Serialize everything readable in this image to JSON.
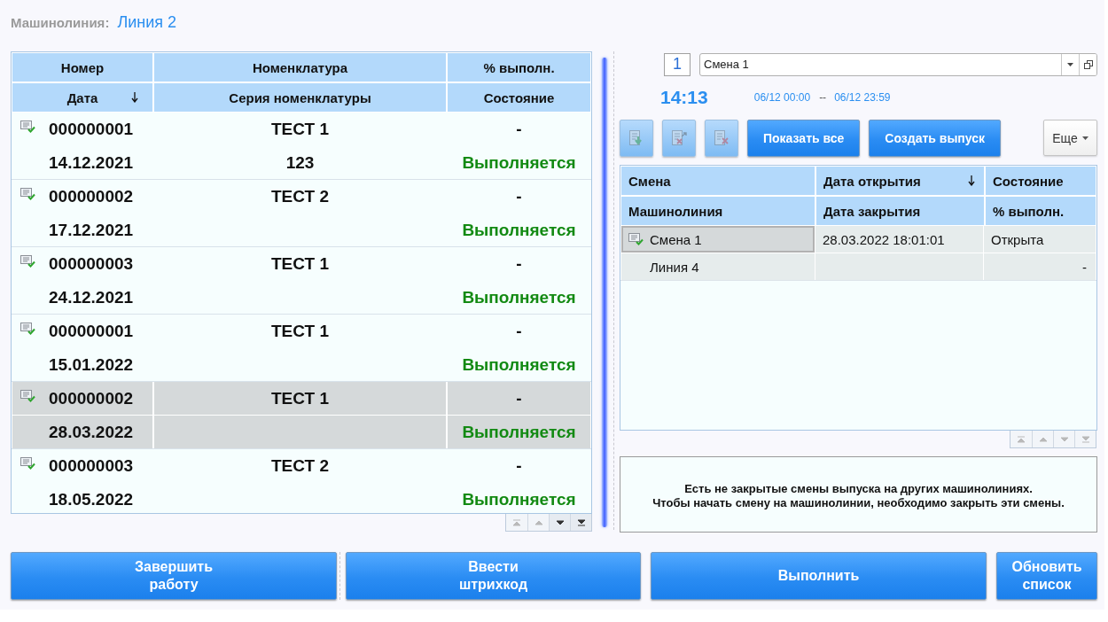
{
  "header": {
    "label": "Машинолиния:",
    "value": "Линия 2"
  },
  "orders_table": {
    "header_rows": [
      [
        {
          "label": "Номер",
          "sorted": false
        },
        {
          "label": "Номенклатура",
          "sorted": false
        },
        {
          "label": "% выполн.",
          "sorted": false
        }
      ],
      [
        {
          "label": "Дата",
          "sorted": true
        },
        {
          "label": "Серия номенклатуры",
          "sorted": false
        },
        {
          "label": "Состояние",
          "sorted": false
        }
      ]
    ],
    "rows": [
      {
        "number": "000000001",
        "date": "14.12.2021",
        "nomenclature": "ТЕСТ 1",
        "series": "123",
        "percent": "-",
        "status": "Выполняется",
        "selected": false
      },
      {
        "number": "000000002",
        "date": "17.12.2021",
        "nomenclature": "ТЕСТ 2",
        "percent": "-",
        "status": "Выполняется",
        "selected": false
      },
      {
        "number": "000000003",
        "date": "24.12.2021",
        "nomenclature": "ТЕСТ 1",
        "percent": "-",
        "status": "Выполняется",
        "selected": false
      },
      {
        "number": "000000001",
        "date": "15.01.2022",
        "nomenclature": "ТЕСТ 1",
        "percent": "-",
        "status": "Выполняется",
        "selected": false
      },
      {
        "number": "000000002",
        "date": "28.03.2022",
        "nomenclature": "ТЕСТ 1",
        "percent": "-",
        "status": "Выполняется",
        "selected": true
      },
      {
        "number": "000000003",
        "date": "18.05.2022",
        "nomenclature": "ТЕСТ 2",
        "percent": "-",
        "status": "Выполняется",
        "selected": false
      }
    ],
    "scroll_buttons": [
      {
        "kind": "first",
        "disabled": true
      },
      {
        "kind": "previous",
        "disabled": true
      },
      {
        "kind": "next",
        "disabled": false
      },
      {
        "kind": "last",
        "disabled": false
      }
    ]
  },
  "shift_picker": {
    "number": "1",
    "value": "Смена 1"
  },
  "clock": {
    "time": "14:13",
    "period_start": "06/12 00:00",
    "separator": "--",
    "period_end": "06/12 23:59"
  },
  "toolbar": {
    "icon_buttons": [
      {
        "kind": "load",
        "disabled": true
      },
      {
        "kind": "unload",
        "disabled": true
      },
      {
        "kind": "remove",
        "disabled": true
      }
    ],
    "buttons": [
      {
        "label": "Показать все",
        "kind": "primary"
      },
      {
        "label": "Создать выпуск",
        "kind": "primary"
      },
      {
        "label": "Еще",
        "kind": "menu"
      }
    ]
  },
  "shifts_table": {
    "header_rows": [
      [
        {
          "label": "Смена",
          "sorted": false
        },
        {
          "label": "Дата открытия",
          "sorted": true
        },
        {
          "label": "Состояние",
          "sorted": false
        }
      ],
      [
        {
          "label": "Машинолиния",
          "sorted": false
        },
        {
          "label": "Дата закрытия",
          "sorted": false
        },
        {
          "label": "% выполн.",
          "sorted": false
        }
      ]
    ],
    "rows": [
      {
        "shift": "Смена 1",
        "opened": "28.03.2022 18:01:01",
        "state": "Открыта",
        "line": "Линия 4",
        "percent": "-",
        "selected": true
      }
    ],
    "scroll_buttons": [
      {
        "kind": "first",
        "disabled": true
      },
      {
        "kind": "previous",
        "disabled": true
      },
      {
        "kind": "next",
        "disabled": true
      },
      {
        "kind": "last",
        "disabled": true
      }
    ]
  },
  "message": [
    "Есть не закрытые смены выпуска на других машинолиниях.",
    "Чтобы начать смену на машинолинии, необходимо закрыть эти смены."
  ],
  "actions": [
    {
      "label": "Завершить\nработу"
    },
    {
      "label": "Ввести\nштрихкод"
    },
    {
      "label": "Выполнить"
    },
    {
      "label": "Обновить\nсписок"
    }
  ]
}
